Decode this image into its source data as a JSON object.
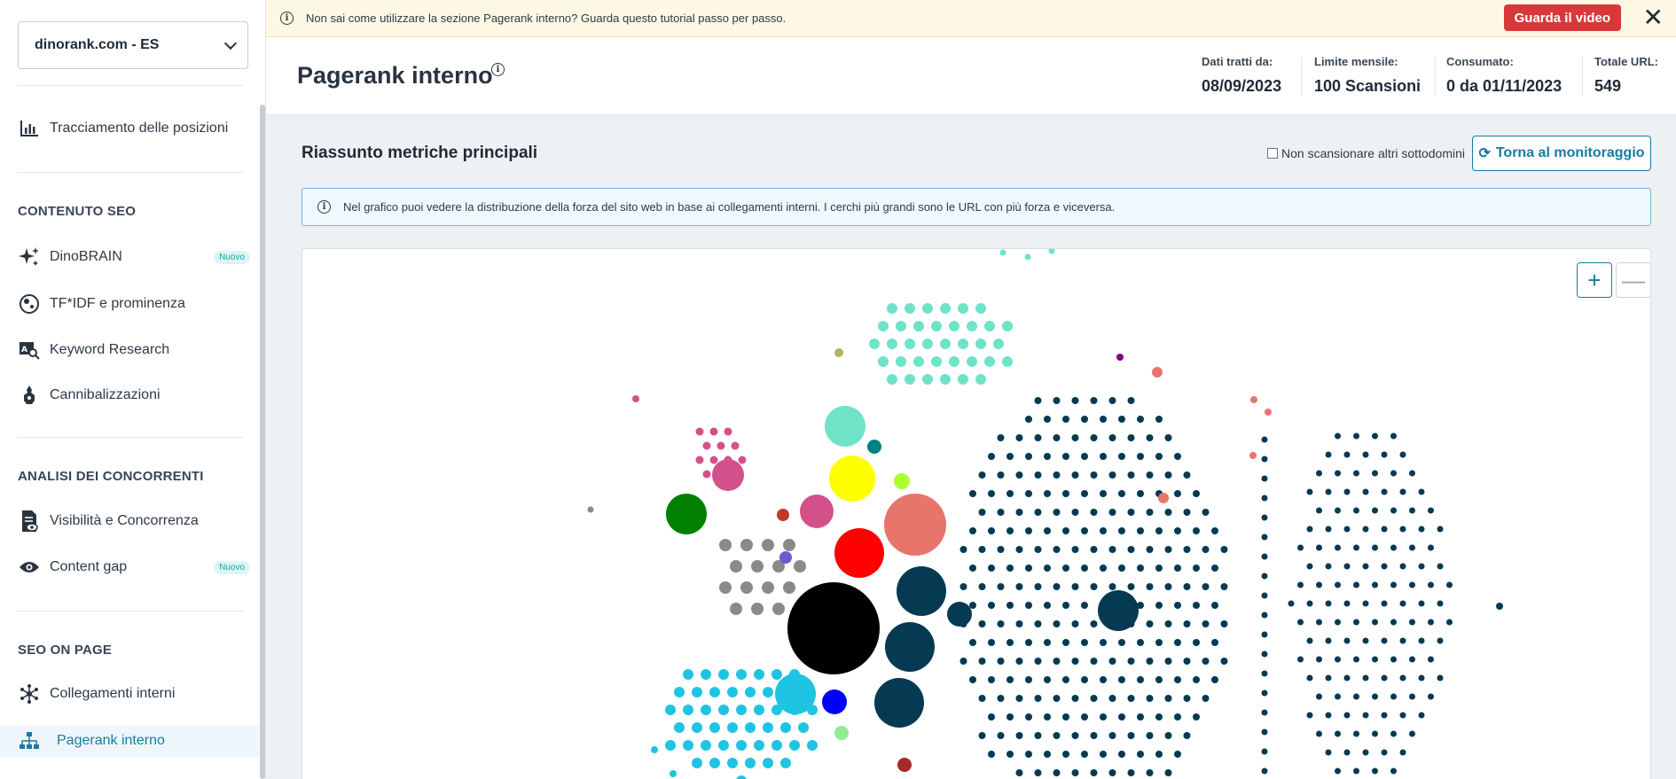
{
  "sidebar": {
    "project": "dinorank.com - ES",
    "tracking": "Tracciamento delle posizioni",
    "sections": {
      "seo_content": "CONTENUTO SEO",
      "competitors": "ANALISI DEI CONCORRENTI",
      "onpage": "SEO ON PAGE"
    },
    "items": {
      "dinobrain": "DinoBRAIN",
      "tfidf": "TF*IDF e prominenza",
      "keyword": "Keyword Research",
      "cannibal": "Cannibalizzazioni",
      "visibility": "Visibilità e Concorrenza",
      "contentgap": "Content gap",
      "links": "Collegamenti interni",
      "pagerank": "Pagerank interno"
    },
    "badge_new": "Nuovo"
  },
  "banner": {
    "text": "Non sai come utilizzare la sezione Pagerank interno? Guarda questo tutorial passo per passo.",
    "button": "Guarda il video"
  },
  "header": {
    "title": "Pagerank interno",
    "stats": [
      {
        "label": "Dati tratti da:",
        "value": "08/09/2023"
      },
      {
        "label": "Limite mensile:",
        "value": "100 Scansioni"
      },
      {
        "label": "Consumato:",
        "value": "0 da 01/11/2023"
      },
      {
        "label": "Totale URL:",
        "value": "549"
      }
    ]
  },
  "metrics": {
    "title": "Riassunto metriche principali",
    "checkbox_label": "Non scansionare altri sottodomini",
    "back_button": "Torna al monitoraggio",
    "info": "Nel grafico puoi vedere la distribuzione della forza del sito web in base ai collegamenti interni. I cerchi più grandi sono le URL con più forza e viceversa."
  },
  "graph": {
    "zoom_in": "+",
    "zoom_out": "—",
    "colors": {
      "navy": "#063a52",
      "teal": "#6fe3c7",
      "cyan": "#1fc4e3",
      "pink": "#d4508b",
      "gray": "#8a8a8a",
      "salmon": "#e8756b"
    }
  }
}
